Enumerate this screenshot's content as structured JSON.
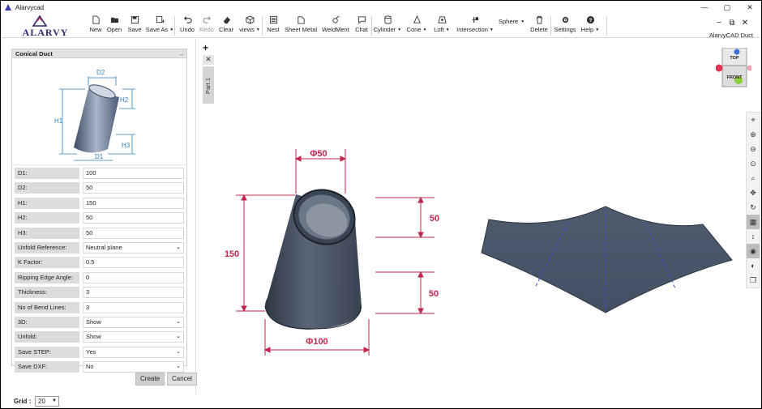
{
  "window": {
    "title": "Alarvycad",
    "controls": [
      "—",
      "▢",
      "✕"
    ]
  },
  "brand": {
    "logo_text": "ALARVY",
    "product": "AlarvyCAD Duct"
  },
  "ribbon": {
    "tools": [
      {
        "label": "New",
        "icon": "new-file-icon"
      },
      {
        "label": "Open",
        "icon": "folder-icon"
      },
      {
        "label": "Save",
        "icon": "save-icon"
      },
      {
        "label": "Save As",
        "icon": "save-as-icon",
        "dropdown": true
      },
      {
        "label": "Undo",
        "icon": "undo-icon"
      },
      {
        "label": "Redo",
        "icon": "redo-icon",
        "disabled": true
      },
      {
        "label": "Clear",
        "icon": "eraser-icon"
      },
      {
        "label": "views",
        "icon": "cube-icon",
        "dropdown": true
      },
      {
        "label": "Nest",
        "icon": "nest-icon"
      },
      {
        "label": "Sheet Metal",
        "icon": "sheet-metal-icon"
      },
      {
        "label": "WeldMent",
        "icon": "weldment-icon"
      },
      {
        "label": "Chat",
        "icon": "chat-icon"
      },
      {
        "label": "Cylinder",
        "icon": "cylinder-icon",
        "dropdown": true
      },
      {
        "label": "Cone",
        "icon": "cone-icon",
        "dropdown": true
      },
      {
        "label": "Loft",
        "icon": "loft-icon",
        "dropdown": true
      },
      {
        "label": "Intersection",
        "icon": "intersection-icon",
        "dropdown": true
      },
      {
        "label": "Delete",
        "icon": "trash-icon"
      },
      {
        "label": "Settings",
        "icon": "gear-icon"
      },
      {
        "label": "Help",
        "icon": "help-icon",
        "dropdown": true
      }
    ],
    "sphere": "Sphere"
  },
  "panel": {
    "title": "Conical Duct",
    "diagram_labels": {
      "d1": "D1",
      "d2": "D2",
      "h1": "H1",
      "h2": "H2",
      "h3": "H3"
    },
    "properties": [
      {
        "label": "D1:",
        "value": "100"
      },
      {
        "label": "D2:",
        "value": "50"
      },
      {
        "label": "H1:",
        "value": "150"
      },
      {
        "label": "H2:",
        "value": "50"
      },
      {
        "label": "H3:",
        "value": "50"
      },
      {
        "label": "Unfold Reference:",
        "value": "Neutral plane",
        "dropdown": true
      },
      {
        "label": "K Factor:",
        "value": "0.5"
      },
      {
        "label": "Ripping Edge Angle:",
        "value": "0"
      },
      {
        "label": "Thickness:",
        "value": "3"
      },
      {
        "label": "No of Bend Lines:",
        "value": "3"
      },
      {
        "label": "3D:",
        "value": "Show",
        "dropdown": true
      },
      {
        "label": "Unfold:",
        "value": "Show",
        "dropdown": true
      },
      {
        "label": "Save STEP:",
        "value": "Yes",
        "dropdown": true
      },
      {
        "label": "Save DXF:",
        "value": "No",
        "dropdown": true
      }
    ],
    "create_label": "Create",
    "cancel_label": "Cancel"
  },
  "tabs": {
    "add": "+",
    "close": "✕",
    "part_label": "Part 1"
  },
  "model": {
    "top_diameter": "Φ50",
    "height": "150",
    "h2": "50",
    "h3": "50",
    "bottom_diameter": "Φ100"
  },
  "viewcube": {
    "top": "TOP",
    "front": "FRONT"
  },
  "right_toolbar": [
    "mouse-icon",
    "zoom-in-icon",
    "zoom-out-icon",
    "zoom-fit-icon",
    "zoom-window-icon",
    "pan-icon",
    "rotate-icon",
    "grid-icon",
    "vertical-icon",
    "eye-icon",
    "contrast-icon",
    "layers-icon"
  ],
  "bottom": {
    "grid_label": "Grid :",
    "grid_value": "20"
  },
  "colors": {
    "dim": "#c0264f",
    "model": "#4a5566",
    "panel_header": "#e2e2e2"
  }
}
